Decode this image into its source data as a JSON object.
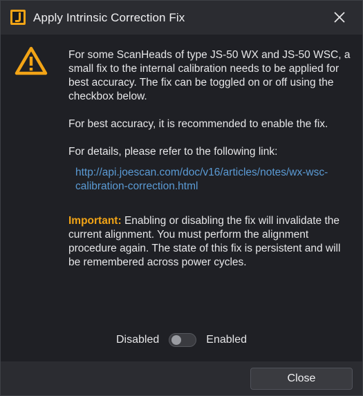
{
  "window": {
    "title": "Apply Intrinsic Correction Fix",
    "logo_icon": "joescan-logo-icon",
    "close_icon": "close-icon"
  },
  "content": {
    "warning_icon": "warning-icon",
    "warning_color": "#f2a416",
    "paragraph1": "For some ScanHeads of type JS-50 WX and JS-50 WSC, a small fix to the internal calibration needs to be applied for best accuracy. The fix can be toggled on or off using the checkbox below.",
    "paragraph2": "For best accuracy, it is recommended to enable the fix.",
    "paragraph3": "For details, please refer to the following link:",
    "link": "http://api.joescan.com/doc/v16/articles/notes/wx-wsc-calibration-correction.html",
    "link_color": "#5b9bd5",
    "important_label": "Important:",
    "important_color": "#f2a416",
    "important_text": " Enabling or disabling the fix will invalidate the current alignment. You must perform the alignment procedure again. The state of this fix is persistent and will be remembered across power cycles."
  },
  "toggle": {
    "off_label": "Disabled",
    "on_label": "Enabled",
    "enabled": false
  },
  "footer": {
    "close_label": "Close"
  }
}
